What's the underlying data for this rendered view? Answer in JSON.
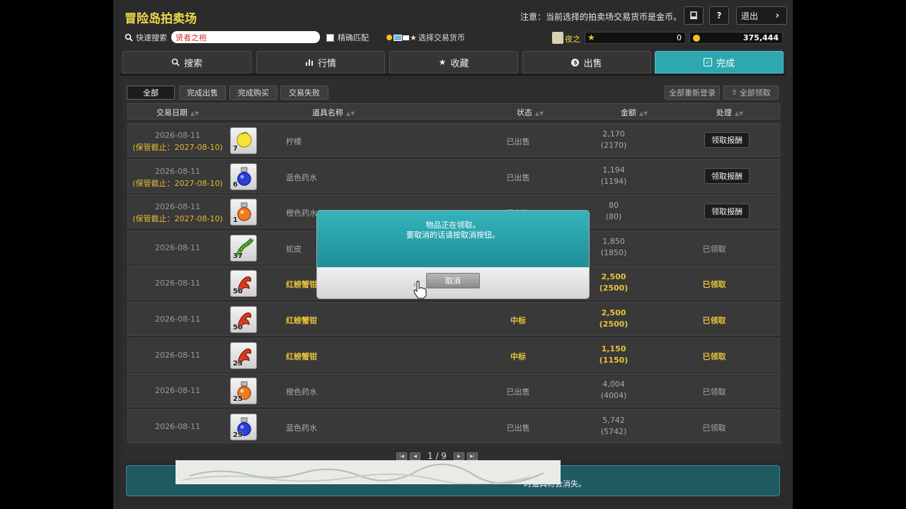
{
  "header": {
    "title": "冒险岛拍卖场",
    "notice": "注意：当前选择的拍卖场交易货币是金币。",
    "exit_label": "退出",
    "help_label": "?"
  },
  "search": {
    "label": "快速搜索",
    "value": "贤者之袍",
    "exact_match": "精确匹配",
    "currency_select": "选择交易货币"
  },
  "status": {
    "character_name": "夜之",
    "points": "0",
    "meso": "375,444"
  },
  "tabs": [
    {
      "label": "搜索",
      "icon": "search-icon"
    },
    {
      "label": "行情",
      "icon": "bar-chart-icon"
    },
    {
      "label": "收藏",
      "icon": "star-icon"
    },
    {
      "label": "出售",
      "icon": "coin-icon"
    },
    {
      "label": "完成",
      "icon": "checkbox-icon"
    }
  ],
  "filters": [
    "全部",
    "完成出售",
    "完成购买",
    "交易失败"
  ],
  "bulk_actions": {
    "relist_all": "全部重新登录",
    "claim_all": "全部领取"
  },
  "columns": {
    "date": "交易日期",
    "item": "道具名称",
    "status": "状态",
    "amount": "金额",
    "action": "处理"
  },
  "rows": [
    {
      "date": "2026-08-11",
      "keep": "(保管截止：2027-08-10)",
      "qty": "7",
      "item_icon": "lemon-icon",
      "name": "柠檬",
      "status": "已出售",
      "amount": "2,170",
      "amount_sub": "(2170)",
      "action": "领取报酬",
      "action_button": true,
      "highlight": false
    },
    {
      "date": "2026-08-11",
      "keep": "(保管截止：2027-08-10)",
      "qty": "6",
      "item_icon": "blue-potion-icon",
      "name": "蓝色药水",
      "status": "已出售",
      "amount": "1,194",
      "amount_sub": "(1194)",
      "action": "领取报酬",
      "action_button": true,
      "highlight": false
    },
    {
      "date": "2026-08-11",
      "keep": "(保管截止：2027-08-10)",
      "qty": "1",
      "item_icon": "orange-potion-icon",
      "name": "橙色药水",
      "status": "已出售",
      "amount": "80",
      "amount_sub": "(80)",
      "action": "领取报酬",
      "action_button": true,
      "highlight": false
    },
    {
      "date": "2026-08-11",
      "keep": "",
      "qty": "37",
      "item_icon": "snake-skin-icon",
      "name": "蛇皮",
      "status": "",
      "amount": "1,850",
      "amount_sub": "(1850)",
      "action": "已领取",
      "action_button": false,
      "highlight": false
    },
    {
      "date": "2026-08-11",
      "keep": "",
      "qty": "50",
      "item_icon": "crab-claw-icon",
      "name": "红螃蟹钳",
      "status": "",
      "amount": "2,500",
      "amount_sub": "(2500)",
      "action": "已领取",
      "action_button": false,
      "highlight": true
    },
    {
      "date": "2026-08-11",
      "keep": "",
      "qty": "50",
      "item_icon": "crab-claw-icon",
      "name": "红螃蟹钳",
      "status": "中标",
      "amount": "2,500",
      "amount_sub": "(2500)",
      "action": "已领取",
      "action_button": false,
      "highlight": true
    },
    {
      "date": "2026-08-11",
      "keep": "",
      "qty": "23",
      "item_icon": "crab-claw-icon",
      "name": "红螃蟹钳",
      "status": "中标",
      "amount": "1,150",
      "amount_sub": "(1150)",
      "action": "已领取",
      "action_button": false,
      "highlight": true
    },
    {
      "date": "2026-08-11",
      "keep": "",
      "qty": "25",
      "item_icon": "orange-potion-icon",
      "name": "橙色药水",
      "status": "已出售",
      "amount": "4,004",
      "amount_sub": "(4004)",
      "action": "已领取",
      "action_button": false,
      "highlight": false
    },
    {
      "date": "2026-08-11",
      "keep": "",
      "qty": "29",
      "item_icon": "blue-potion-icon",
      "name": "蓝色药水",
      "status": "已出售",
      "amount": "5,742",
      "amount_sub": "(5742)",
      "action": "已领取",
      "action_button": false,
      "highlight": false
    }
  ],
  "pagination": {
    "text": "1 / 9"
  },
  "info": {
    "text": "时道具将会消失。"
  },
  "dialog": {
    "line1": "物品正在领取。",
    "line2": "要取消的话请按取消按钮。",
    "cancel_label": "取消"
  },
  "colors": {
    "accent": "#2fa7b0",
    "gold": "#e8c23a",
    "title": "#f0d84a"
  }
}
